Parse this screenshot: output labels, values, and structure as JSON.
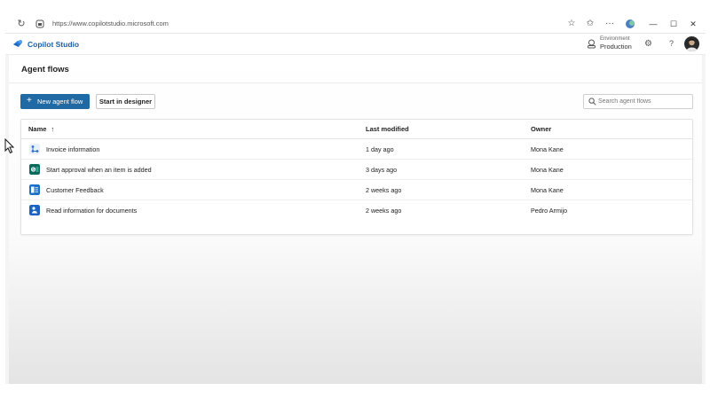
{
  "browser": {
    "url": "https://www.copilotstudio.microsoft.com"
  },
  "app": {
    "name": "Copilot Studio",
    "environment_label": "Environment",
    "environment_value": "Production"
  },
  "page": {
    "title": "Agent flows",
    "new_button_label": "New agent flow",
    "designer_button_label": "Start in designer",
    "search_placeholder": "Search agent flows"
  },
  "table": {
    "columns": {
      "name": "Name",
      "sort_indicator": "↑",
      "modified": "Last modified",
      "owner": "Owner"
    },
    "rows": [
      {
        "name": "Invoice information",
        "modified": "1 day ago",
        "owner": "Mona Kane",
        "icon": "flow-icon",
        "icon_color": "#e8f1fb"
      },
      {
        "name": "Start approval when an item is added",
        "modified": "3 days ago",
        "owner": "Mona Kane",
        "icon": "sharepoint-icon",
        "icon_color": "#0b6a5b"
      },
      {
        "name": "Customer Feedback",
        "modified": "2 weeks ago",
        "owner": "Mona Kane",
        "icon": "forms-icon",
        "icon_color": "#1e6fc8"
      },
      {
        "name": "Read information for documents",
        "modified": "2 weeks ago",
        "owner": "Pedro Armijo",
        "icon": "document-icon",
        "icon_color": "#1d63c4"
      }
    ]
  },
  "colors": {
    "accent": "#1f6aa5",
    "brand_text": "#1b5ea8"
  }
}
